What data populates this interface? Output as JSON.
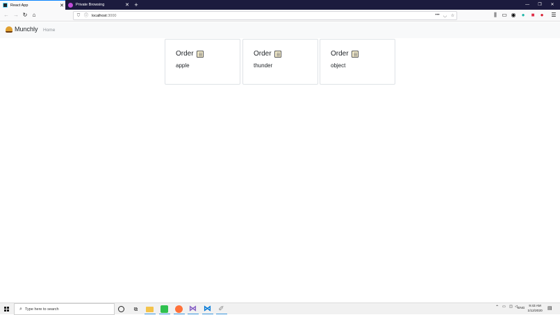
{
  "browser": {
    "tabs": [
      {
        "label": "React App",
        "active": true
      },
      {
        "label": "Private Browsing",
        "active": false
      }
    ],
    "new_tab": "+",
    "window_controls": {
      "minimize": "—",
      "maximize": "❐",
      "close": "✕"
    },
    "url": {
      "host": "localhost",
      "port": ":3000"
    }
  },
  "app": {
    "brand": "Munchly",
    "nav_links": [
      "Home"
    ],
    "cards": [
      {
        "title": "Order",
        "body": "apple"
      },
      {
        "title": "Order",
        "body": "thunder"
      },
      {
        "title": "Order",
        "body": "object"
      }
    ]
  },
  "taskbar": {
    "search_placeholder": "Type here to search",
    "language": "ENG",
    "time": "9:43 AM",
    "date": "1/12/2020"
  },
  "colors": {
    "tabbar_bg": "#1c1b3e",
    "accent": "#0a84ff"
  }
}
